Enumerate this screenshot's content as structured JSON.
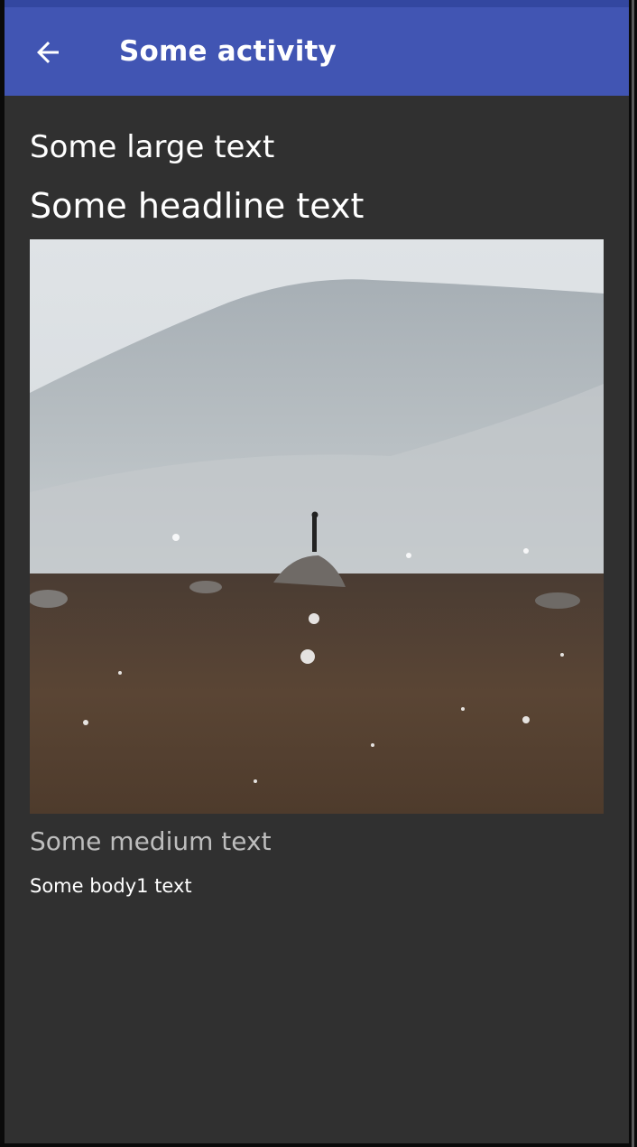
{
  "app_bar": {
    "title": "Some activity",
    "back_icon": "arrow-back-icon"
  },
  "content": {
    "large_text": "Some large text",
    "headline_text": "Some headline text",
    "medium_text": "Some medium text",
    "body1_text": "Some body1 text"
  },
  "colors": {
    "primary": "#4155b3",
    "primary_dark": "#3347a0",
    "background": "#303030"
  }
}
